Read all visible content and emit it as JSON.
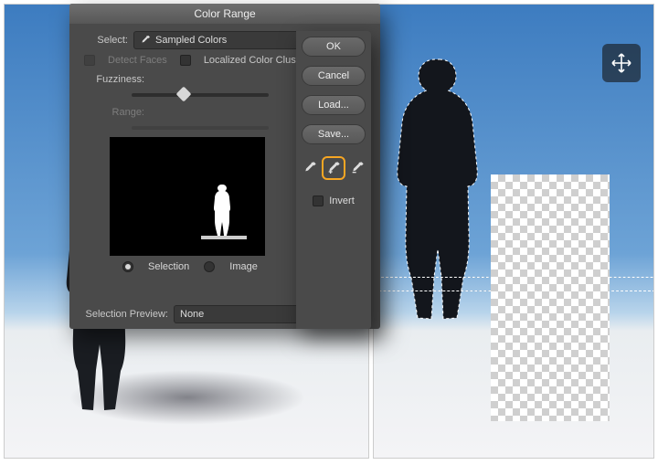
{
  "dialog": {
    "title": "Color Range",
    "select_label": "Select:",
    "select_value": "Sampled Colors",
    "detect_faces": "Detect Faces",
    "localized_clusters": "Localized Color Clusters",
    "fuzziness_label": "Fuzziness:",
    "fuzziness_value": "87",
    "range_label": "Range:",
    "range_unit": "%",
    "radio_selection": "Selection",
    "radio_image": "Image",
    "selection_preview_label": "Selection Preview:",
    "selection_preview_value": "None"
  },
  "buttons": {
    "ok": "OK",
    "cancel": "Cancel",
    "load": "Load...",
    "save": "Save...",
    "invert": "Invert"
  },
  "eyedroppers": {
    "base": "eyedropper",
    "add": "eyedropper-add",
    "sub": "eyedropper-subtract"
  },
  "overlay": {
    "move_tool": "move"
  }
}
